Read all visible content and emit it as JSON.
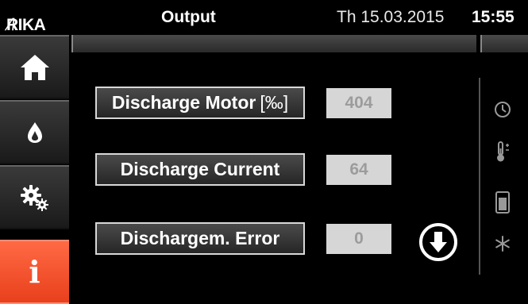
{
  "header": {
    "logo": "RIKA",
    "title": "Output",
    "date": "Th 15.03.2015",
    "time": "15:55"
  },
  "sidebar": {
    "items": [
      {
        "icon": "home-icon"
      },
      {
        "icon": "flame-icon"
      },
      {
        "icon": "gears-icon"
      },
      {
        "icon": "info-icon",
        "label": "i",
        "active": true
      }
    ]
  },
  "outputs": [
    {
      "label": "Discharge Motor",
      "unit": "[‰]",
      "value": "404"
    },
    {
      "label": "Discharge Current",
      "value": "64"
    },
    {
      "label": "Dischargem. Error",
      "value": "0"
    }
  ],
  "right_icons": [
    "clock-icon",
    "thermometer-icon",
    "stove-icon",
    "snowflake-icon"
  ],
  "colors": {
    "accent": "#ee4b24",
    "value_bg": "#d6d6d6",
    "value_text": "#9c9c9c"
  }
}
